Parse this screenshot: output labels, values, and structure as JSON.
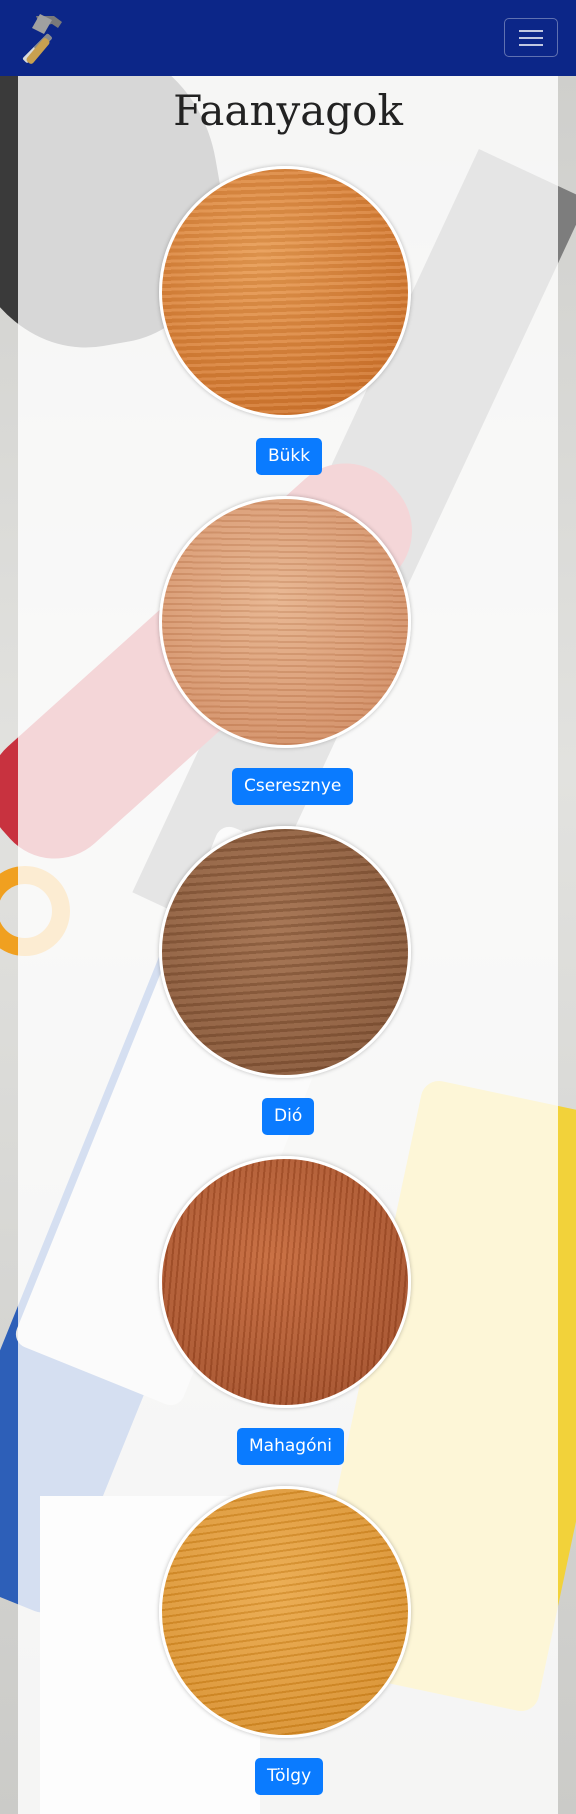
{
  "navbar": {
    "brand_icon": "hammer-icon",
    "toggler_icon": "hamburger-icon",
    "background_color": "#0c2688"
  },
  "page": {
    "title": "Faanyagok"
  },
  "woods": [
    {
      "label": "Bükk",
      "swatch": "beech"
    },
    {
      "label": "Cseresznye",
      "swatch": "cherry"
    },
    {
      "label": "Dió",
      "swatch": "walnut"
    },
    {
      "label": "Mahagóni",
      "swatch": "mahogany"
    },
    {
      "label": "Tölgy",
      "swatch": "oak"
    }
  ],
  "colors": {
    "button": "#0a7bff",
    "button_text": "#ffffff"
  }
}
